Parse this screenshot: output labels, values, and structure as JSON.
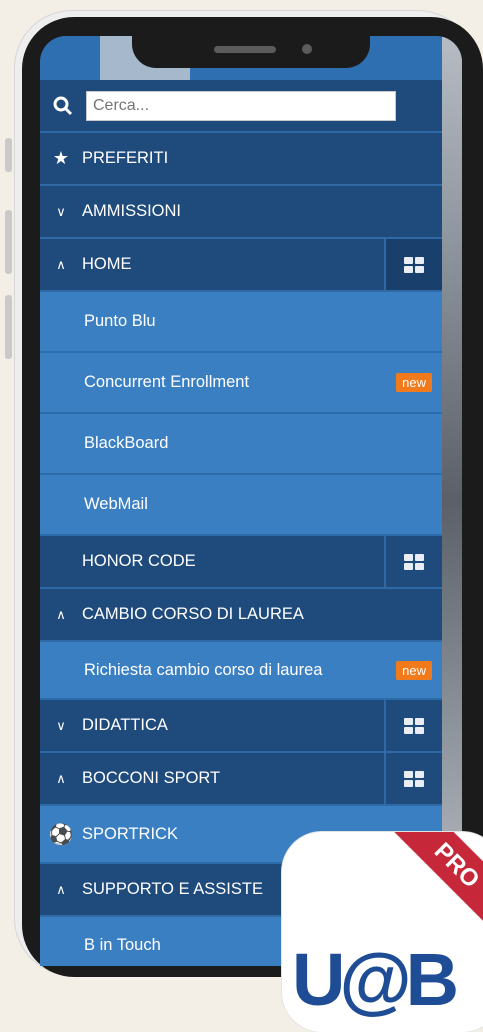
{
  "search": {
    "placeholder": "Cerca..."
  },
  "menu": {
    "favorites": "PREFERITI",
    "admissions": "AMMISSIONI",
    "home": "HOME",
    "home_items": [
      "Punto Blu",
      "Concurrent Enrollment",
      "BlackBoard",
      "WebMail"
    ],
    "new_badge": "new",
    "honor_code": "HONOR CODE",
    "change_course": "CAMBIO CORSO DI LAUREA",
    "change_course_item": "Richiesta cambio corso di laurea",
    "teaching": "DIDATTICA",
    "bocconi_sport": "BOCCONI SPORT",
    "sportrick": "SPORTRICK",
    "support": "SUPPORTO E ASSISTE",
    "b_in_touch": "B in Touch"
  },
  "app_icon": {
    "ribbon": "PRO",
    "logo_text": "U@B"
  },
  "colors": {
    "dark_row": "#1f4a7c",
    "light_row": "#3b7fc3",
    "badge": "#f07a1c",
    "ribbon": "#c62839"
  },
  "icons": [
    "search-icon",
    "star-icon",
    "chevron-down-icon",
    "chevron-up-icon",
    "grid-icon",
    "soccer-ball-icon"
  ]
}
